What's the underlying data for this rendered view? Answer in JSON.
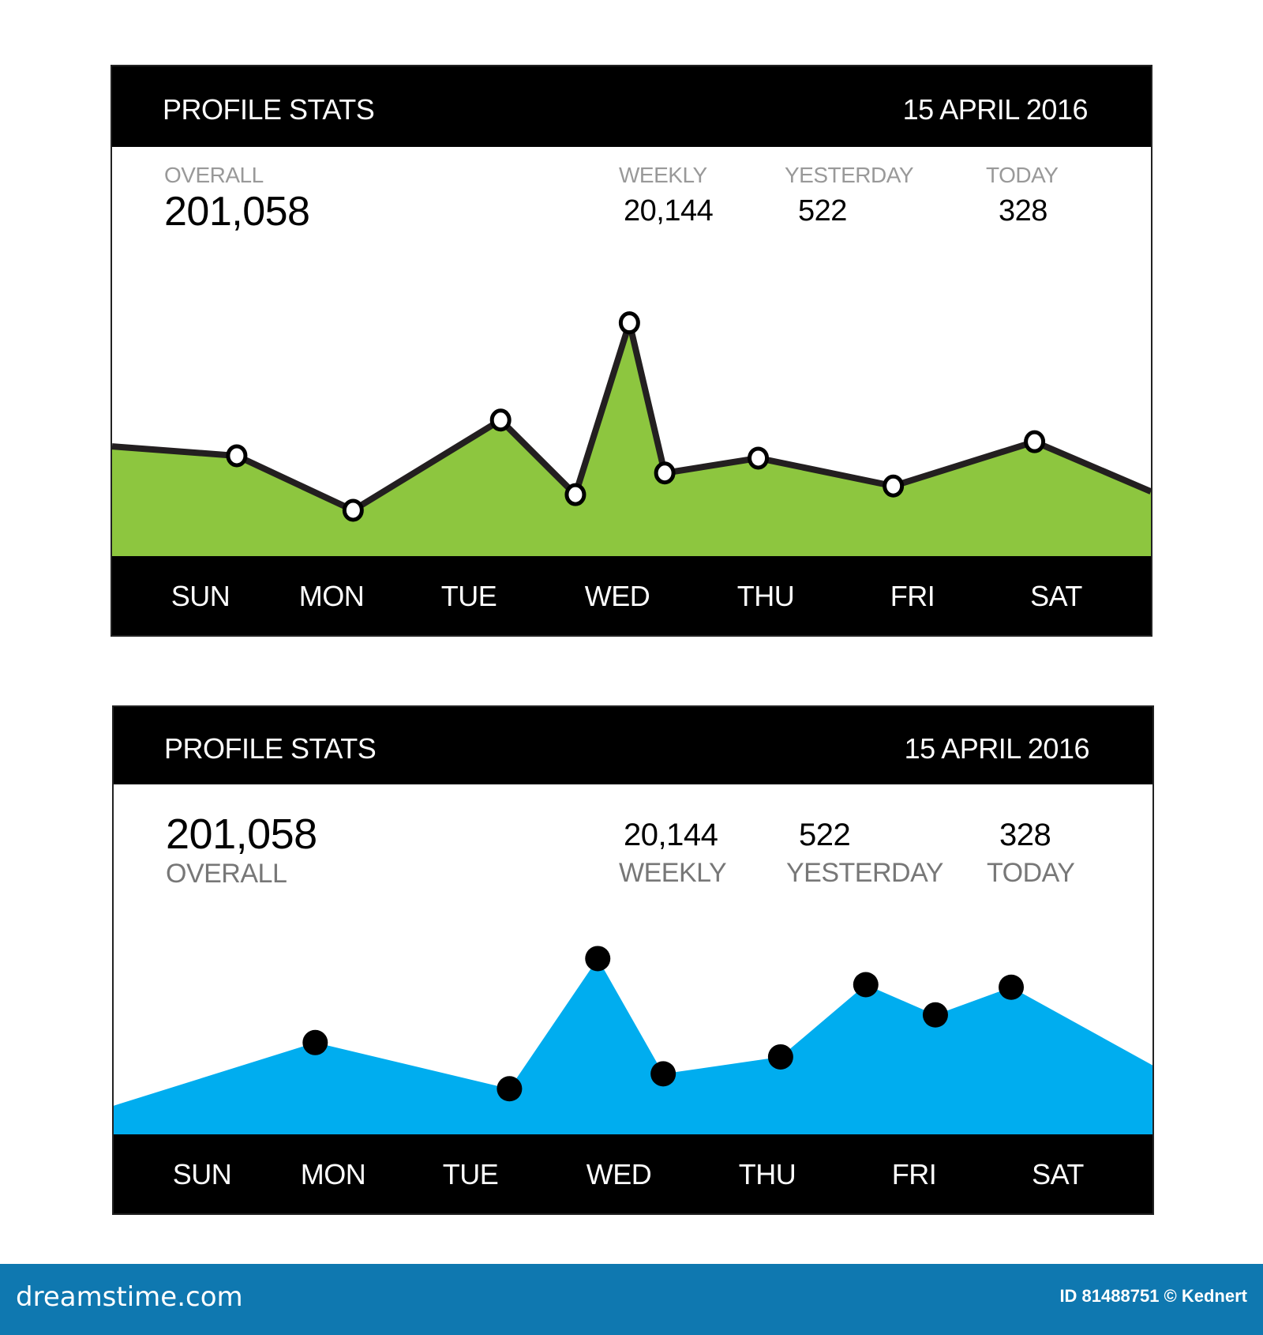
{
  "cards": [
    {
      "header": {
        "title": "PROFILE STATS",
        "date": "15 APRIL 2016"
      },
      "stats": {
        "overall": {
          "label": "OVERALL",
          "value": "201,058"
        },
        "weekly": {
          "label": "WEEKLY",
          "value": "20,144"
        },
        "yesterday": {
          "label": "YESTERDAY",
          "value": "522"
        },
        "today": {
          "label": "TODAY",
          "value": "328"
        }
      },
      "days": [
        "SUN",
        "MON",
        "TUE",
        "WED",
        "THU",
        "FRI",
        "SAT"
      ],
      "colors": {
        "fill": "#8dc63f",
        "line": "#231f20",
        "marker_fill": "#ffffff",
        "marker_stroke": "#000000"
      }
    },
    {
      "header": {
        "title": "PROFILE STATS",
        "date": "15 APRIL 2016"
      },
      "stats": {
        "overall": {
          "label": "OVERALL",
          "value": "201,058"
        },
        "weekly": {
          "label": "WEEKLY",
          "value": "20,144"
        },
        "yesterday": {
          "label": "YESTERDAY",
          "value": "522"
        },
        "today": {
          "label": "TODAY",
          "value": "328"
        }
      },
      "days": [
        "SUN",
        "MON",
        "TUE",
        "WED",
        "THU",
        "FRI",
        "SAT"
      ],
      "colors": {
        "fill": "#00adef",
        "marker_fill": "#000000"
      }
    }
  ],
  "chart_data": [
    {
      "type": "area",
      "title": "PROFILE STATS",
      "subtitle": "15 APRIL 2016",
      "xlabel": "",
      "ylabel": "",
      "categories": [
        "SUN",
        "MON",
        "TUE",
        "WED",
        "THU",
        "FRI",
        "SAT"
      ],
      "ylim": [
        0,
        100
      ],
      "grid": false,
      "x_fraction": [
        0,
        0.12,
        0.232,
        0.374,
        0.446,
        0.498,
        0.532,
        0.622,
        0.752,
        0.888,
        1
      ],
      "values": [
        42.7,
        39.1,
        18.2,
        52.8,
        24.2,
        90.1,
        32.5,
        38.2,
        27.5,
        44.5,
        25.4
      ],
      "markers": [
        false,
        true,
        true,
        true,
        true,
        true,
        true,
        true,
        true,
        true,
        false
      ]
    },
    {
      "type": "area",
      "title": "PROFILE STATS",
      "subtitle": "15 APRIL 2016",
      "xlabel": "",
      "ylabel": "",
      "categories": [
        "SUN",
        "MON",
        "TUE",
        "WED",
        "THU",
        "FRI",
        "SAT"
      ],
      "ylim": [
        0,
        100
      ],
      "grid": false,
      "x_fraction": [
        0,
        0.194,
        0.381,
        0.466,
        0.529,
        0.642,
        0.724,
        0.791,
        0.864,
        1
      ],
      "values": [
        15.6,
        47.3,
        24.1,
        89.5,
        31.6,
        40.1,
        76.4,
        61.2,
        75.1,
        35.9
      ],
      "markers": [
        false,
        true,
        true,
        true,
        true,
        true,
        true,
        true,
        true,
        false
      ]
    }
  ],
  "footer": {
    "brand": "dreamstime.com",
    "credit": "ID 81488751 © Kednert"
  }
}
